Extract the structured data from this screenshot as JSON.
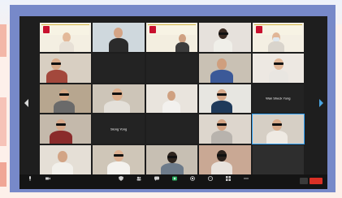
{
  "participants": [
    {
      "name": "",
      "label": "",
      "kind": "banner"
    },
    {
      "name": "",
      "label": "",
      "kind": "person"
    },
    {
      "name": "",
      "label": "",
      "kind": "banner"
    },
    {
      "name": "",
      "label": "",
      "kind": "person"
    },
    {
      "name": "",
      "label": "",
      "kind": "banner"
    },
    {
      "name": "",
      "label": "",
      "kind": "person"
    },
    {
      "name": "",
      "label": "",
      "kind": "name-only"
    },
    {
      "name": "",
      "label": "",
      "kind": "name-only"
    },
    {
      "name": "",
      "label": "",
      "kind": "person"
    },
    {
      "name": "",
      "label": "",
      "kind": "person"
    },
    {
      "name": "",
      "label": "",
      "kind": "person"
    },
    {
      "name": "",
      "label": "",
      "kind": "person"
    },
    {
      "name": "",
      "label": "",
      "kind": "person"
    },
    {
      "name": "",
      "label": "",
      "kind": "person"
    },
    {
      "name": "",
      "label": "Wan Sheck Yung",
      "kind": "name-only"
    },
    {
      "name": "",
      "label": "",
      "kind": "person"
    },
    {
      "name": "",
      "label": "Siong Yong",
      "kind": "name-only"
    },
    {
      "name": "",
      "label": "",
      "kind": "name-only"
    },
    {
      "name": "",
      "label": "",
      "kind": "person"
    },
    {
      "name": "",
      "label": "",
      "kind": "person"
    },
    {
      "name": "",
      "label": "",
      "kind": "person"
    },
    {
      "name": "",
      "label": "",
      "kind": "person"
    },
    {
      "name": "",
      "label": "",
      "kind": "person"
    },
    {
      "name": "",
      "label": "",
      "kind": "person"
    },
    {
      "name": "",
      "label": "",
      "kind": "dark"
    }
  ],
  "toolbar": {
    "items": [
      {
        "icon": "microphone-icon",
        "label": ""
      },
      {
        "icon": "video-camera-icon",
        "label": ""
      },
      {
        "icon": "security-shield-icon",
        "label": ""
      },
      {
        "icon": "participants-icon",
        "label": ""
      },
      {
        "icon": "chat-icon",
        "label": ""
      },
      {
        "icon": "share-screen-icon",
        "label": ""
      },
      {
        "icon": "record-icon",
        "label": ""
      },
      {
        "icon": "reactions-icon",
        "label": ""
      },
      {
        "icon": "apps-icon",
        "label": ""
      },
      {
        "icon": "more-icon",
        "label": ""
      }
    ],
    "end_label": ""
  },
  "colors": {
    "frame": "#7789c9",
    "window": "#1e1e1e",
    "end_button": "#d93025",
    "share_green": "#27ae60"
  }
}
